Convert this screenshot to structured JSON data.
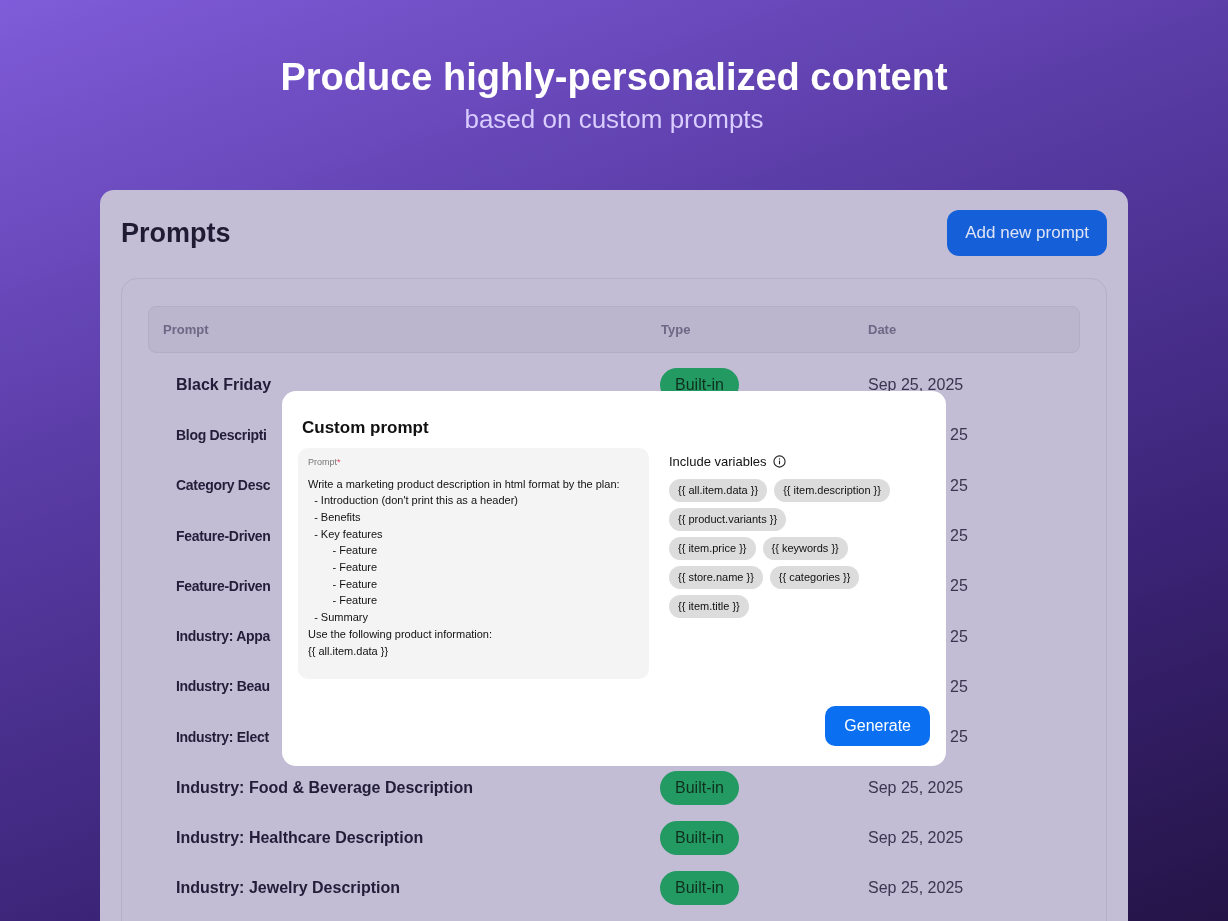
{
  "hero": {
    "title": "Produce highly-personalized content",
    "subtitle": "based on custom prompts"
  },
  "page": {
    "title": "Prompts",
    "add_button": "Add new prompt"
  },
  "table": {
    "columns": [
      "Prompt",
      "Type",
      "Date"
    ],
    "rows": [
      {
        "kind": "full",
        "name": "Black Friday",
        "type": "Built-in",
        "date": "Sep 25, 2025"
      },
      {
        "kind": "covered",
        "name": "Blog Descripti",
        "date": "25"
      },
      {
        "kind": "covered",
        "name": "Category Desc",
        "date": "25"
      },
      {
        "kind": "covered",
        "name": "Feature-Driven",
        "date": "25"
      },
      {
        "kind": "covered",
        "name": "Feature-Driven",
        "date": "25"
      },
      {
        "kind": "covered",
        "name": "Industry: Appa",
        "date": "25"
      },
      {
        "kind": "covered",
        "name": "Industry: Beau",
        "date": "25"
      },
      {
        "kind": "covered",
        "name": "Industry: Elect",
        "date": "25"
      },
      {
        "kind": "full",
        "name": "Industry: Food & Beverage Description",
        "type": "Built-in",
        "date": "Sep 25, 2025"
      },
      {
        "kind": "full",
        "name": "Industry: Healthcare Description",
        "type": "Built-in",
        "date": "Sep 25, 2025"
      },
      {
        "kind": "full",
        "name": "Industry: Jewelry Description",
        "type": "Built-in",
        "date": "Sep 25, 2025"
      }
    ]
  },
  "modal": {
    "title": "Custom prompt",
    "prompt_label": "Prompt",
    "required_mark": "*",
    "prompt_value": "Write a marketing product description in html format by the plan:\n  - Introduction (don't print this as a header)\n  - Benefits\n  - Key features\n        - Feature\n        - Feature\n        - Feature\n        - Feature\n  - Summary\nUse the following product information:\n{{ all.item.data }}",
    "variables_label": "Include variables",
    "variable_rows": [
      [
        "{{ all.item.data }}",
        "{{ item.description }}"
      ],
      [
        "{{ product.variants }}"
      ],
      [
        "{{ item.price }}",
        "{{ keywords }}"
      ],
      [
        "{{ store.name }}",
        "{{ categories }}"
      ],
      [
        "{{ item.title }}"
      ]
    ],
    "generate_button": "Generate"
  }
}
